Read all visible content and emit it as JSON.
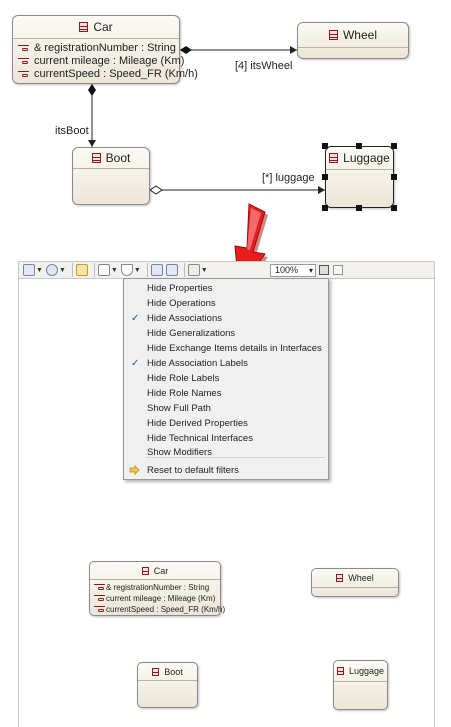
{
  "top_diagram": {
    "car": {
      "name": "Car",
      "attributes": [
        "& registrationNumber : String",
        "current mileage : Mileage (Km)",
        "currentSpeed : Speed_FR (Km/h)"
      ]
    },
    "wheel": {
      "name": "Wheel"
    },
    "boot": {
      "name": "Boot"
    },
    "luggage": {
      "name": "Luggage"
    },
    "labels": {
      "its_wheel": "[4] itsWheel",
      "its_boot": "itsBoot",
      "luggage": "[*] luggage"
    }
  },
  "toolbar": {
    "zoom": "100%"
  },
  "menu": {
    "items": [
      {
        "label": "Hide Properties",
        "checked": false
      },
      {
        "label": "Hide Operations",
        "checked": false
      },
      {
        "label": "Hide Associations",
        "checked": true
      },
      {
        "label": "Hide Generalizations",
        "checked": false
      },
      {
        "label": "Hide Exchange Items details in Interfaces",
        "checked": false
      },
      {
        "label": "Hide Association Labels",
        "checked": true
      },
      {
        "label": "Hide Role Labels",
        "checked": false
      },
      {
        "label": "Hide Role Names",
        "checked": false
      },
      {
        "label": "Show Full Path",
        "checked": false
      },
      {
        "label": "Hide Derived Properties",
        "checked": false
      },
      {
        "label": "Hide Technical Interfaces",
        "checked": false
      },
      {
        "label": "Show Modifiers",
        "checked": false
      }
    ],
    "reset_label": "Reset to default filters",
    "check_glyph": "✓"
  },
  "bottom_diagram": {
    "car": {
      "name": "Car",
      "attributes": [
        "& registrationNumber : String",
        "current mileage : Mileage (Km)",
        "currentSpeed : Speed_FR (Km/h)"
      ]
    },
    "wheel": {
      "name": "Wheel"
    },
    "boot": {
      "name": "Boot"
    },
    "luggage": {
      "name": "Luggage"
    }
  },
  "colors": {
    "arrow_fill": "#e81c1c",
    "check": "#1f5fb8",
    "class_icon": "#8b1a1a"
  }
}
